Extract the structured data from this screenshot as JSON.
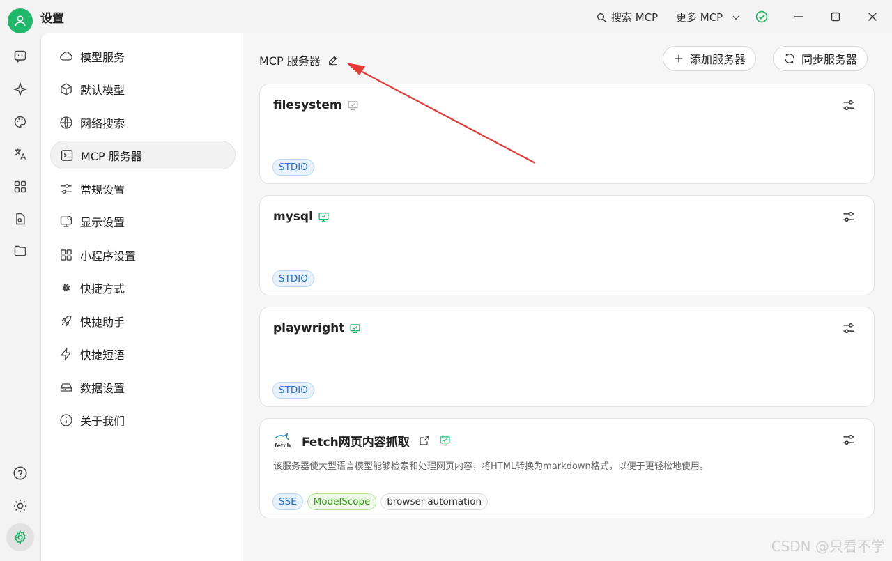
{
  "titlebar": {
    "app_title": "设置",
    "search_mcp": "搜索 MCP",
    "more_mcp": "更多 MCP"
  },
  "rail": {
    "icons": [
      "chat-icon",
      "sparkle-icon",
      "palette-icon",
      "translate-icon",
      "grid-icon",
      "file-search-icon",
      "folder-icon",
      "help-icon",
      "sun-icon",
      "settings-icon"
    ]
  },
  "menu": {
    "items": [
      {
        "label": "模型服务",
        "icon": "cloud-icon"
      },
      {
        "label": "默认模型",
        "icon": "cube-icon"
      },
      {
        "label": "网络搜索",
        "icon": "globe-icon"
      },
      {
        "label": "MCP 服务器",
        "icon": "terminal-icon",
        "active": true
      },
      {
        "label": "常规设置",
        "icon": "sliders-icon"
      },
      {
        "label": "显示设置",
        "icon": "monitor-icon"
      },
      {
        "label": "小程序设置",
        "icon": "apps-icon"
      },
      {
        "label": "快捷方式",
        "icon": "command-icon"
      },
      {
        "label": "快捷助手",
        "icon": "rocket-icon"
      },
      {
        "label": "快捷短语",
        "icon": "zap-icon"
      },
      {
        "label": "数据设置",
        "icon": "drive-icon"
      },
      {
        "label": "关于我们",
        "icon": "info-icon"
      }
    ]
  },
  "content": {
    "section_title": "MCP 服务器",
    "add_server": "添加服务器",
    "sync_server": "同步服务器",
    "servers": [
      {
        "name": "filesystem",
        "tags": [
          "STDIO"
        ],
        "active": false
      },
      {
        "name": "mysql",
        "tags": [
          "STDIO"
        ],
        "active": true
      },
      {
        "name": "playwright",
        "tags": [
          "STDIO"
        ],
        "active": true
      },
      {
        "name": "Fetch网页内容抓取",
        "logo_text": "fetch",
        "description": "该服务器使大型语言模型能够检索和处理网页内容，将HTML转换为markdown格式，以便于更轻松地使用。",
        "tags": [
          "SSE",
          "ModelScope",
          "browser-automation"
        ],
        "active": true
      }
    ]
  },
  "watermark": "CSDN @只看不学",
  "colors": {
    "accent_green": "#1fb86a",
    "annotation_red": "#e53935",
    "tag_blue": "#1f6fd0",
    "tag_green": "#3a9a19"
  }
}
